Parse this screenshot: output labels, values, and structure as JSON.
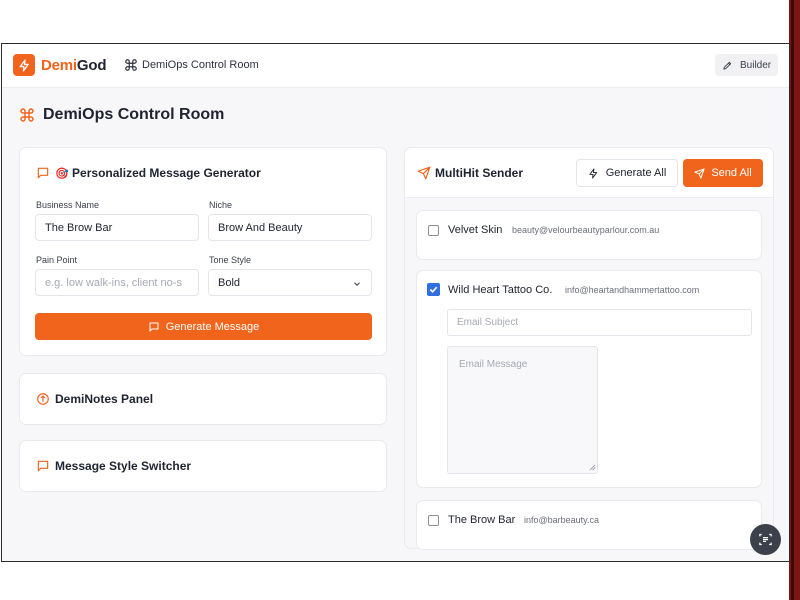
{
  "colors": {
    "accent": "#f1641b",
    "checkbox_checked": "#2f6fe0",
    "fab": "#3c404b"
  },
  "app": {
    "brand_part1": "Demi",
    "brand_part2": "God",
    "nav_title": "DemiOps Control Room",
    "builder_label": "Builder"
  },
  "page": {
    "title": "DemiOps Control Room"
  },
  "generator": {
    "title": "Personalized Message Generator",
    "emoji": "🎯",
    "business_name_label": "Business Name",
    "business_name_value": "The Brow Bar",
    "niche_label": "Niche",
    "niche_value": "Brow And Beauty",
    "pain_point_label": "Pain Point",
    "pain_point_placeholder": "e.g. low walk-ins, client no-s",
    "tone_label": "Tone Style",
    "tone_value": "Bold",
    "generate_label": "Generate Message"
  },
  "panels": {
    "notes_title": "DemiNotes Panel",
    "style_title": "Message Style Switcher"
  },
  "sender": {
    "title": "MultiHit Sender",
    "generate_all_label": "Generate All",
    "send_all_label": "Send All",
    "recipients": [
      {
        "name": "Velvet Skin",
        "email": "beauty@velourbeautyparlour.com.au",
        "checked": false
      },
      {
        "name": "Wild Heart Tattoo Co.",
        "email": "info@heartandhammertattoo.com",
        "checked": true
      },
      {
        "name": "The Brow Bar",
        "email": "info@barbeauty.ca",
        "checked": false
      }
    ],
    "subject_placeholder": "Email Subject",
    "message_placeholder": "Email Message"
  },
  "icons": {
    "logo": "bolt-icon",
    "nav": "command-icon",
    "builder": "pen-icon",
    "generator": "message-square-icon",
    "notes": "compass-icon",
    "style": "message-square-icon",
    "sender": "send-icon",
    "generate_all": "bolt-icon",
    "send_all": "send-icon",
    "fab": "scan-text-icon"
  }
}
